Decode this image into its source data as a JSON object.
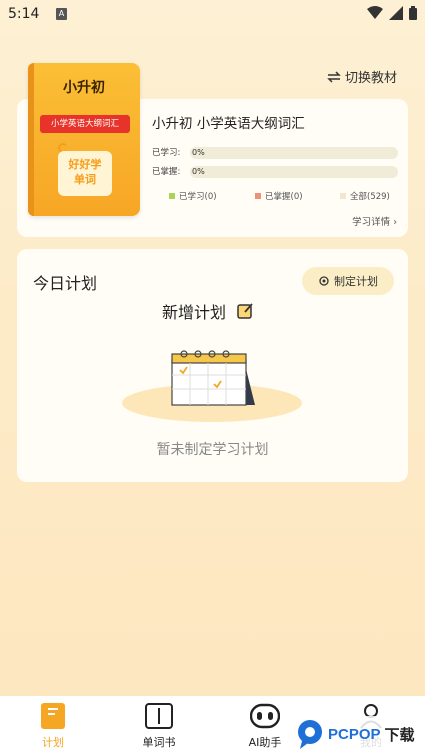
{
  "status_bar": {
    "time": "5:14",
    "sim_label": "A"
  },
  "switch_textbook": {
    "label": "切换教材"
  },
  "book": {
    "cover_title": "小升初",
    "cover_tag": "小学英语大纲词汇",
    "cover_logo_line1": "好好学",
    "cover_logo_line2": "单词",
    "title": "小升初 小学英语大纲词汇",
    "learned_label": "已学习:",
    "learned_value": "0%",
    "learned_fraction": 0,
    "mastered_label": "已掌握:",
    "mastered_value": "0%",
    "mastered_fraction": 0,
    "legend": [
      {
        "label": "已学习(0)",
        "color": "#a9d35a"
      },
      {
        "label": "已掌握(0)",
        "color": "#f0907a"
      },
      {
        "label": "全部(529)",
        "color": "#efe8cf"
      }
    ],
    "detail_link": "学习详情 ›"
  },
  "plan": {
    "heading": "今日计划",
    "make_plan_button": "制定计划",
    "new_plan_label": "新增计划",
    "empty_text": "暂未制定学习计划"
  },
  "nav": {
    "items": [
      {
        "label": "计划",
        "active": true
      },
      {
        "label": "单词书",
        "active": false
      },
      {
        "label": "AI助手",
        "active": false
      },
      {
        "label": "我的",
        "active": false
      }
    ]
  },
  "watermark": {
    "brand": "PCPOP",
    "suffix": "下载"
  },
  "colors": {
    "accent": "#f5a623",
    "background": "#fdebc8"
  }
}
